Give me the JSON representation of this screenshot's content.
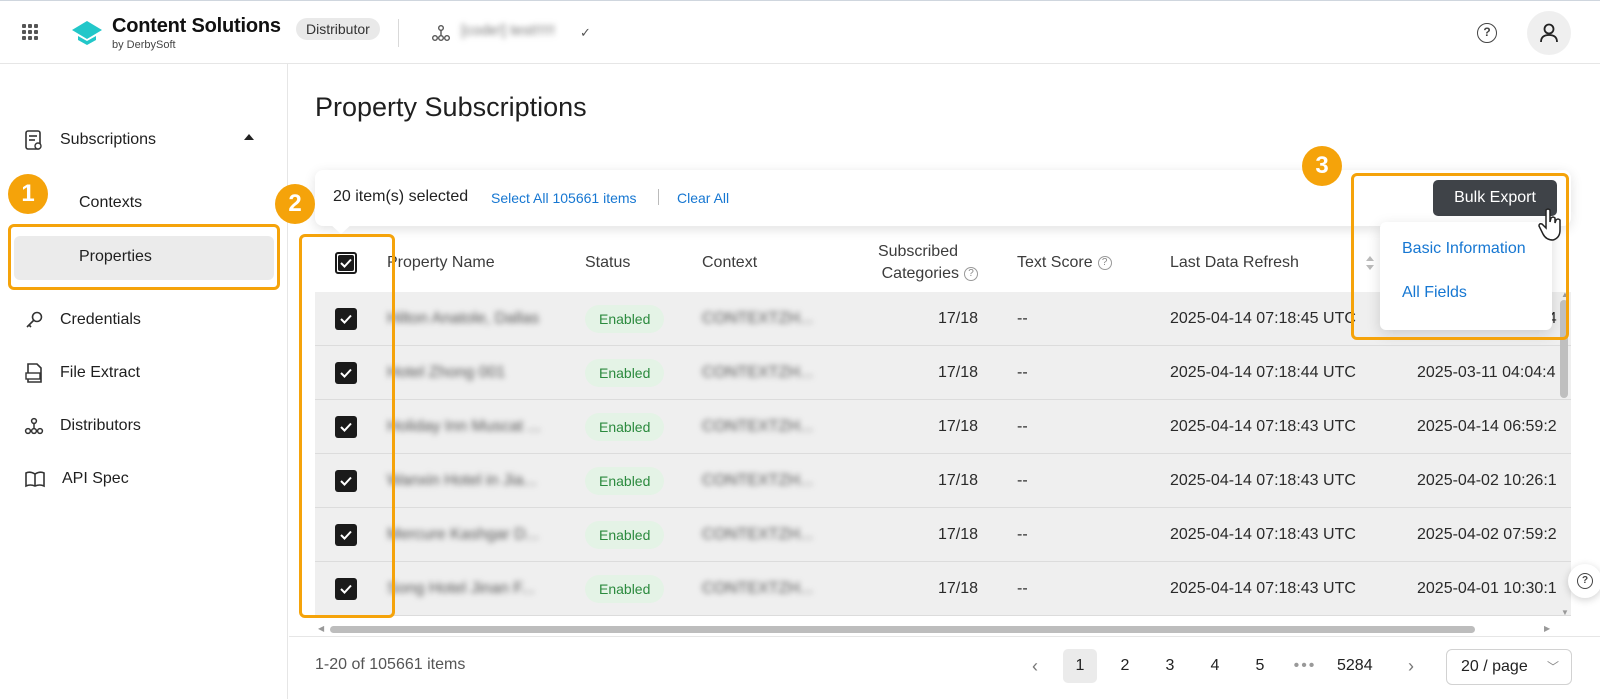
{
  "header": {
    "brand_title": "Content Solutions",
    "brand_sub": "by DerbySoft",
    "role_badge": "Distributor",
    "distributor_name": "[code!] test!!!!!"
  },
  "sidebar": {
    "items": [
      {
        "label": "Subscriptions",
        "icon": "subscriptions-icon"
      },
      {
        "label": "Credentials",
        "icon": "key-icon"
      },
      {
        "label": "File Extract",
        "icon": "file-extract-icon"
      },
      {
        "label": "Distributors",
        "icon": "distributors-icon"
      },
      {
        "label": "API Spec",
        "icon": "book-icon"
      }
    ],
    "sub_items": [
      "Contexts",
      "Properties"
    ]
  },
  "callouts": [
    "1",
    "2",
    "3"
  ],
  "page_title": "Property Subscriptions",
  "selection": {
    "count_text": "20 item(s) selected",
    "select_all": "Select All 105661 items",
    "clear_all": "Clear All",
    "bulk_export": "Bulk Export"
  },
  "bulk_menu": [
    "Basic Information",
    "All Fields"
  ],
  "table": {
    "columns": [
      "Property Name",
      "Status",
      "Context",
      "Subscribed",
      "Categories",
      "Text Score",
      "Last Data Refresh"
    ],
    "rows": [
      {
        "name": "Hilton Anatole, Dallas",
        "status": "Enabled",
        "context": "CONTEXTZH...",
        "categories": "17/18",
        "text_score": "--",
        "refresh": "2025-04-14 07:18:45 UTC",
        "extra": "2025-04-14 07:18:4"
      },
      {
        "name": "Hotel Zhong 001",
        "status": "Enabled",
        "context": "CONTEXTZH...",
        "categories": "17/18",
        "text_score": "--",
        "refresh": "2025-04-14 07:18:44 UTC",
        "extra": "2025-03-11 04:04:4"
      },
      {
        "name": "Holiday Inn Muscat ...",
        "status": "Enabled",
        "context": "CONTEXTZH...",
        "categories": "17/18",
        "text_score": "--",
        "refresh": "2025-04-14 07:18:43 UTC",
        "extra": "2025-04-14 06:59:2"
      },
      {
        "name": "Wanxin Hotel in Jia...",
        "status": "Enabled",
        "context": "CONTEXTZH...",
        "categories": "17/18",
        "text_score": "--",
        "refresh": "2025-04-14 07:18:43 UTC",
        "extra": "2025-04-02 10:26:1"
      },
      {
        "name": "Mercure Kashgar D...",
        "status": "Enabled",
        "context": "CONTEXTZH...",
        "categories": "17/18",
        "text_score": "--",
        "refresh": "2025-04-14 07:18:43 UTC",
        "extra": "2025-04-02 07:59:2"
      },
      {
        "name": "Song Hotel Jinan F...",
        "status": "Enabled",
        "context": "CONTEXTZH...",
        "categories": "17/18",
        "text_score": "--",
        "refresh": "2025-04-14 07:18:43 UTC",
        "extra": "2025-04-01 10:30:1"
      }
    ]
  },
  "pagination": {
    "total": "1-20 of 105661 items",
    "pages": [
      "1",
      "2",
      "3",
      "4",
      "5"
    ],
    "ellipsis": "•••",
    "last": "5284",
    "page_size": "20 / page"
  },
  "colors": {
    "accent": "#f5a30a",
    "link": "#1677d2",
    "enabled_bg": "#e4f3e6",
    "enabled_text": "#2b8a3e",
    "button_dark": "#3f4348",
    "logo_teal": "#22c7c9"
  }
}
